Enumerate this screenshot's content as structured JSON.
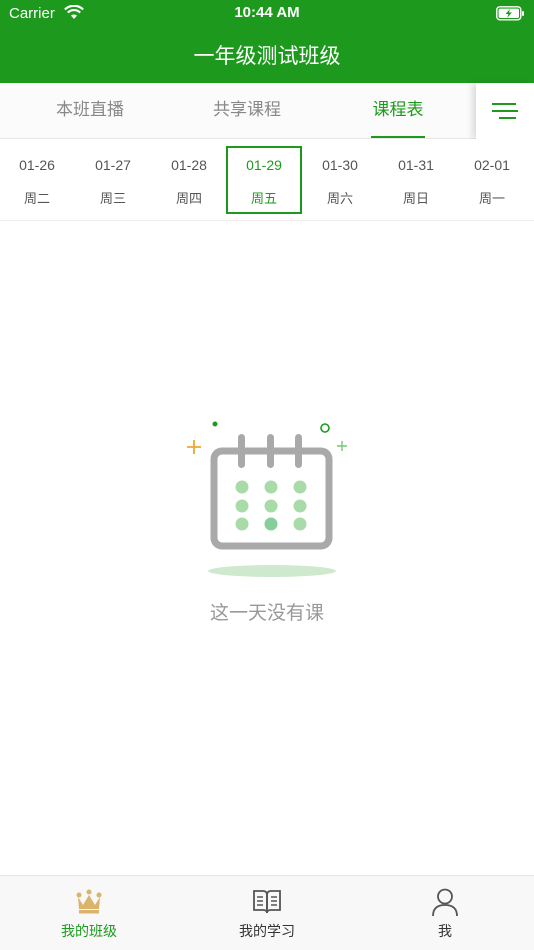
{
  "status_bar": {
    "carrier": "Carrier",
    "time": "10:44 AM"
  },
  "nav": {
    "title": "一年级测试班级"
  },
  "tabs": [
    {
      "label": "本班直播",
      "active": false
    },
    {
      "label": "共享课程",
      "active": false
    },
    {
      "label": "课程表",
      "active": true
    }
  ],
  "dates": [
    {
      "date": "01-26",
      "weekday": "周二"
    },
    {
      "date": "01-27",
      "weekday": "周三"
    },
    {
      "date": "01-28",
      "weekday": "周四"
    },
    {
      "date": "01-29",
      "weekday": "周五",
      "selected": true
    },
    {
      "date": "01-30",
      "weekday": "周六"
    },
    {
      "date": "01-31",
      "weekday": "周日"
    },
    {
      "date": "02-01",
      "weekday": "周一"
    }
  ],
  "empty_state": {
    "message": "这一天没有课",
    "icon": "calendar-icon"
  },
  "bottom_tabs": [
    {
      "label": "我的班级",
      "icon": "crown-icon",
      "active": true
    },
    {
      "label": "我的学习",
      "icon": "book-icon",
      "active": false
    },
    {
      "label": "我",
      "icon": "person-icon",
      "active": false
    }
  ],
  "colors": {
    "brand": "#1d9a1d",
    "muted_text": "#999999",
    "accent_dot": "#a8dba8",
    "crown": "#d9b46a"
  }
}
